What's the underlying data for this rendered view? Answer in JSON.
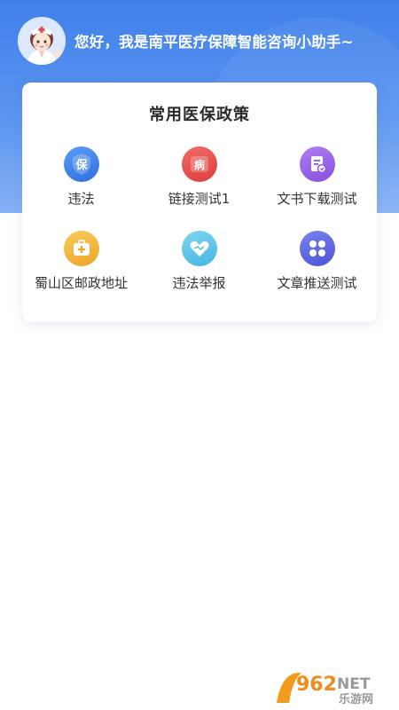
{
  "header": {
    "greeting": "您好，我是南平医疗保障智能咨询小助手~",
    "avatar_icon": "nurse-avatar-icon"
  },
  "card": {
    "title": "常用医保政策",
    "items": [
      {
        "label": "违法",
        "icon": "insurance-shield-icon",
        "color": "#3a7be6",
        "glyph": "保"
      },
      {
        "label": "链接测试1",
        "icon": "disease-icon",
        "color": "#e9534f",
        "glyph": "病"
      },
      {
        "label": "文书下载测试",
        "icon": "document-icon",
        "color": "#9b62e8",
        "glyph": ""
      },
      {
        "label": "蜀山区邮政地址",
        "icon": "medical-kit-icon",
        "color": "#f2b637",
        "glyph": ""
      },
      {
        "label": "违法举报",
        "icon": "handshake-heart-icon",
        "color": "#58c3e8",
        "glyph": ""
      },
      {
        "label": "文章推送测试",
        "icon": "clover-grid-icon",
        "color": "#5b63e0",
        "glyph": ""
      }
    ]
  },
  "watermark": {
    "brand_number": "962",
    "brand_suffix": "NET",
    "brand_cn": "乐游网"
  }
}
